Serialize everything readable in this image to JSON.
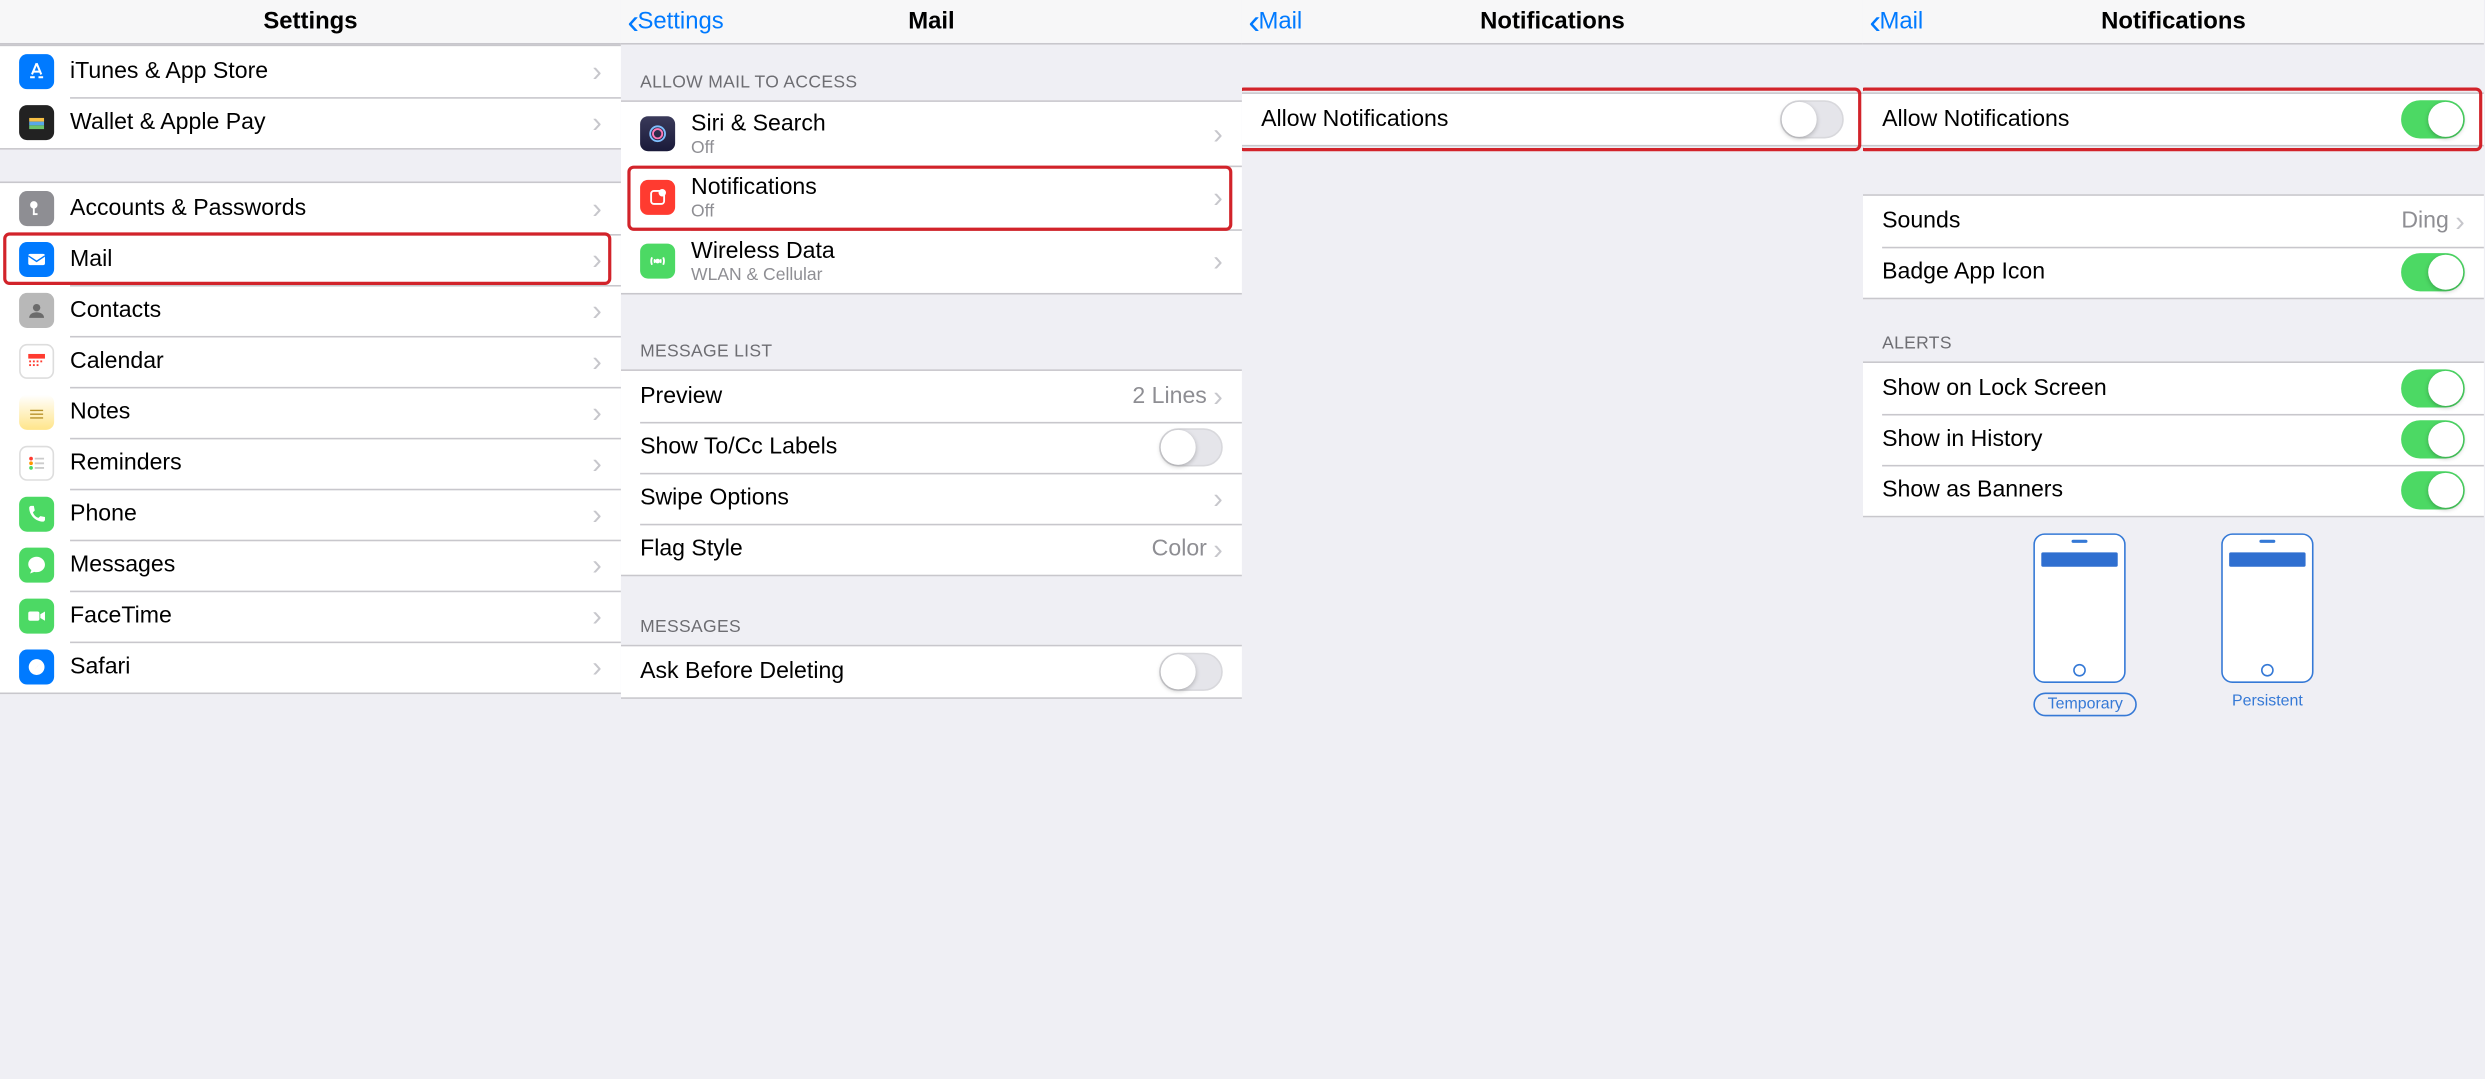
{
  "panel1": {
    "title": "Settings",
    "rows": {
      "itunes": "iTunes & App Store",
      "wallet": "Wallet & Apple Pay",
      "accounts": "Accounts & Passwords",
      "mail": "Mail",
      "contacts": "Contacts",
      "calendar": "Calendar",
      "notes": "Notes",
      "reminders": "Reminders",
      "phone": "Phone",
      "messages": "Messages",
      "facetime": "FaceTime",
      "safari": "Safari"
    }
  },
  "panel2": {
    "back": "Settings",
    "title": "Mail",
    "section_allow": "ALLOW MAIL TO ACCESS",
    "siri": {
      "label": "Siri & Search",
      "sub": "Off"
    },
    "notifications": {
      "label": "Notifications",
      "sub": "Off"
    },
    "wireless": {
      "label": "Wireless Data",
      "sub": "WLAN & Cellular"
    },
    "section_list": "MESSAGE LIST",
    "preview": {
      "label": "Preview",
      "detail": "2 Lines"
    },
    "showto": "Show To/Cc Labels",
    "swipe": "Swipe Options",
    "flag": {
      "label": "Flag Style",
      "detail": "Color"
    },
    "section_messages": "MESSAGES",
    "ask": "Ask Before Deleting"
  },
  "panel3": {
    "back": "Mail",
    "title": "Notifications",
    "allow": "Allow Notifications"
  },
  "panel4": {
    "back": "Mail",
    "title": "Notifications",
    "allow": "Allow Notifications",
    "sounds": {
      "label": "Sounds",
      "detail": "Ding"
    },
    "badge": "Badge App Icon",
    "section_alerts": "ALERTS",
    "lock": "Show on Lock Screen",
    "history": "Show in History",
    "banners": "Show as Banners",
    "temporary": "Temporary",
    "persistent": "Persistent"
  }
}
